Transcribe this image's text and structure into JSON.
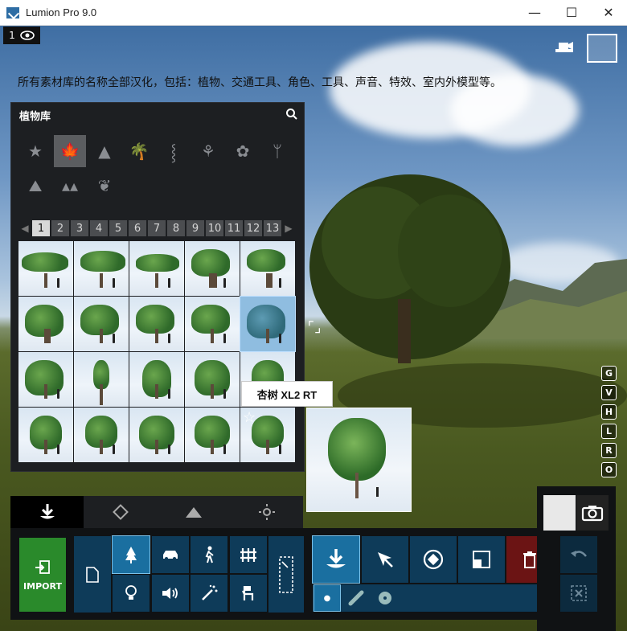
{
  "window": {
    "title": "Lumion Pro 9.0",
    "minimize": "—",
    "maximize": "☐",
    "close": "✕"
  },
  "viewport": {
    "eye_badge_number": "1",
    "note": "所有素材库的名称全部汉化，包括：植物、交通工具、角色、工具、声音、特效、室内外模型等。"
  },
  "library": {
    "title": "植物库",
    "categories": [
      {
        "icon": "star-icon",
        "glyph": "★"
      },
      {
        "icon": "leaf-icon",
        "glyph": "🍁",
        "active": true
      },
      {
        "icon": "conifer-icon",
        "glyph": "▲"
      },
      {
        "icon": "palm-icon",
        "glyph": "🌴"
      },
      {
        "icon": "grass-icon",
        "glyph": "⸾"
      },
      {
        "icon": "plant-icon",
        "glyph": "⚘"
      },
      {
        "icon": "flower-icon",
        "glyph": "✿"
      },
      {
        "icon": "cactus-icon",
        "glyph": "ᛘ"
      },
      {
        "icon": "rock-icon",
        "glyph": "⛰"
      },
      {
        "icon": "forest-icon",
        "glyph": "▴▴"
      },
      {
        "icon": "leaf-single-icon",
        "glyph": "❦"
      }
    ],
    "pages": [
      "1",
      "2",
      "3",
      "4",
      "5",
      "6",
      "7",
      "8",
      "9",
      "10",
      "11",
      "12",
      "13"
    ],
    "active_page": "1",
    "prev": "◀",
    "next": "▶",
    "tooltip": "杏树 XL2 RT"
  },
  "side_keys": [
    "G",
    "V",
    "H",
    "L",
    "R",
    "O"
  ],
  "toolbar": {
    "import_label": "IMPORT"
  }
}
